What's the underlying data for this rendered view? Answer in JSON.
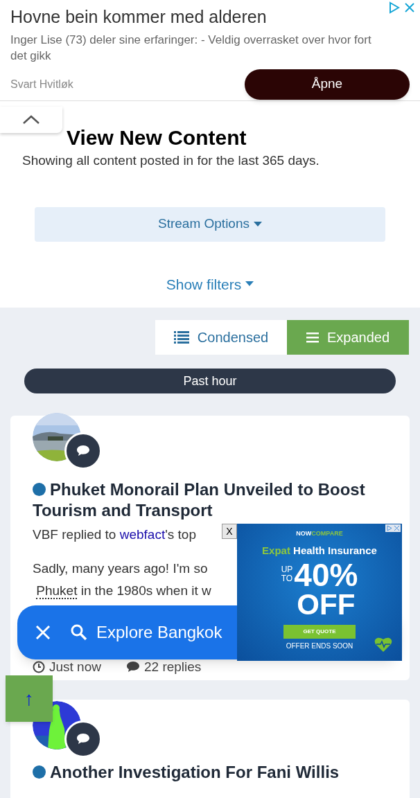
{
  "top_ad": {
    "title": "Hovne bein kommer med alderen",
    "description": "Inger Lise (73) deler sine erfaringer: - Veldig overrasket over hvor fort det gikk",
    "advertiser": "Svart Hvitløk",
    "button": "Åpne"
  },
  "page": {
    "title": "View New Content",
    "subtitle": "Showing all content posted in for the last 365 days."
  },
  "stream_options": {
    "label": "Stream Options"
  },
  "show_filters": {
    "label": "Show filters"
  },
  "view_toggle": [
    {
      "kind": "condensed",
      "label": "Condensed",
      "selected": false
    },
    {
      "kind": "expanded",
      "label": "Expanded",
      "selected": true
    }
  ],
  "time_divider": "Past hour",
  "posts": [
    {
      "unread": true,
      "title": "Phuket Monorail Plan Unveiled to Boost Tourism and Transport",
      "author": "VBF",
      "action": " replied to ",
      "target": "webfact",
      "rest": "'s top",
      "excerpt": [
        {
          "text": "Sadly, many years ago! I'm so"
        },
        {
          "link": "Phuket",
          "text": " in the 1980s when it w"
        }
      ],
      "time": "Just now",
      "replies": "22 replies"
    },
    {
      "unread": true,
      "title": "Another Investigation For Fani Willis"
    }
  ],
  "search_bar": {
    "label": "Explore Bangkok"
  },
  "display_ad": {
    "close": "X",
    "brand_1": "NOW",
    "brand_2": "COMPARE",
    "headline_1": "Expat",
    "headline_2": "Health Insurance",
    "up": "UP",
    "to": "TO",
    "amount": "40%",
    "off": "OFF",
    "button": "GET QUOTE",
    "footer": "OFFER ENDS SOON"
  },
  "scroll_top": {
    "label": "↑"
  }
}
